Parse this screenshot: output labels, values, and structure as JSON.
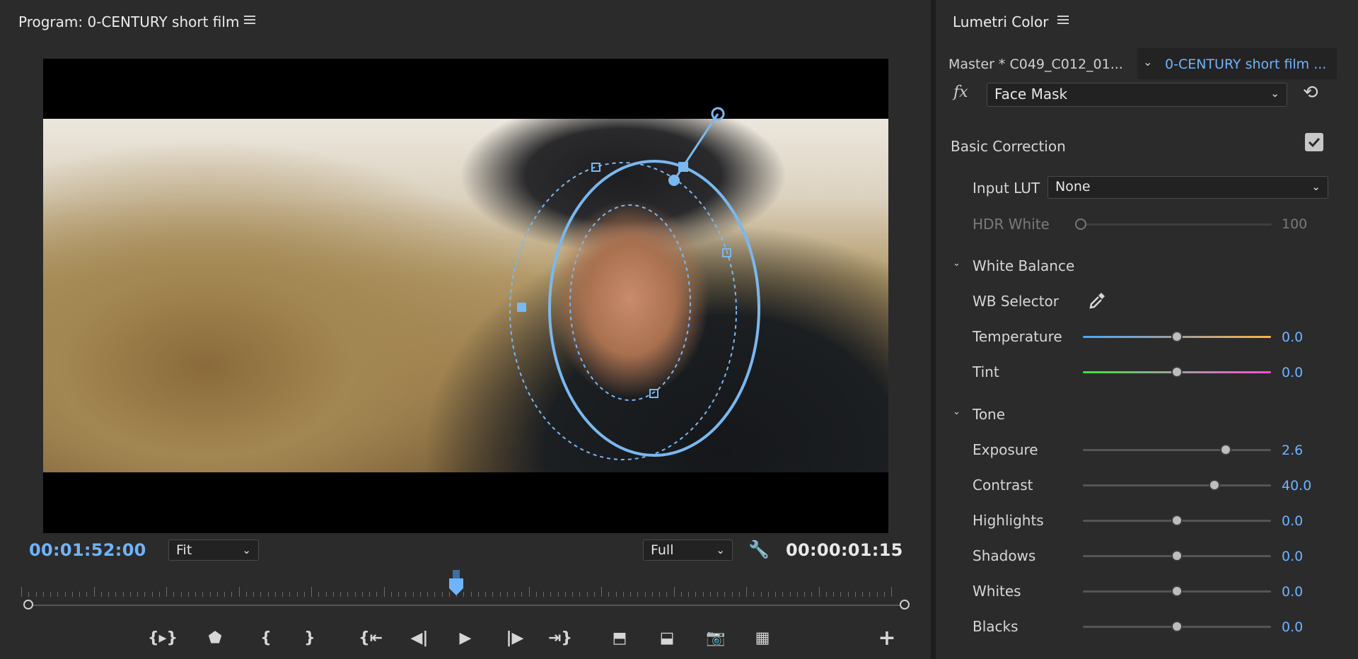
{
  "program": {
    "title": "Program: 0-CENTURY short film",
    "timecode_current": "00:01:52:00",
    "timecode_duration": "00:00:01:15",
    "zoom_select": "Fit",
    "resolution_select": "Full",
    "transport_buttons": [
      {
        "name": "mark-in-out-icon",
        "glyph": "{▸}"
      },
      {
        "name": "add-marker-icon",
        "glyph": "⬟"
      },
      {
        "name": "mark-in-icon",
        "glyph": "{"
      },
      {
        "name": "mark-out-icon",
        "glyph": "}"
      },
      {
        "name": "go-to-in-icon",
        "glyph": "{⇤"
      },
      {
        "name": "step-back-icon",
        "glyph": "◀|"
      },
      {
        "name": "play-icon",
        "glyph": "▶"
      },
      {
        "name": "step-forward-icon",
        "glyph": "|▶"
      },
      {
        "name": "go-to-out-icon",
        "glyph": "⇥}"
      },
      {
        "name": "lift-icon",
        "glyph": "⬒"
      },
      {
        "name": "extract-icon",
        "glyph": "⬓"
      },
      {
        "name": "export-frame-icon",
        "glyph": "📷"
      },
      {
        "name": "comparison-view-icon",
        "glyph": "▦"
      },
      {
        "name": "add-button-icon",
        "glyph": "+"
      }
    ],
    "playhead_position": 0.49
  },
  "lumetri": {
    "title": "Lumetri Color",
    "master_clip": "Master * C049_C012_01...",
    "sequence_clip": "0-CENTURY short film ...",
    "fx_label": "fx",
    "effect_select": "Face Mask",
    "basic_correction": {
      "heading": "Basic Correction",
      "enabled": true,
      "input_lut_label": "Input LUT",
      "input_lut_value": "None",
      "hdr_white_label": "HDR White",
      "hdr_white_value": "100",
      "hdr_white_level": 0.0
    },
    "white_balance": {
      "heading": "White Balance",
      "wb_selector_label": "WB Selector",
      "temperature": {
        "label": "Temperature",
        "value": "0.0",
        "level": 0.5
      },
      "tint": {
        "label": "Tint",
        "value": "0.0",
        "level": 0.5
      }
    },
    "tone": {
      "heading": "Tone",
      "controls": [
        {
          "label": "Exposure",
          "value": "2.6",
          "level": 0.76
        },
        {
          "label": "Contrast",
          "value": "40.0",
          "level": 0.7
        },
        {
          "label": "Highlights",
          "value": "0.0",
          "level": 0.5
        },
        {
          "label": "Shadows",
          "value": "0.0",
          "level": 0.5
        },
        {
          "label": "Whites",
          "value": "0.0",
          "level": 0.5
        },
        {
          "label": "Blacks",
          "value": "0.0",
          "level": 0.5
        }
      ]
    }
  },
  "colors": {
    "accent": "#6fb3ff",
    "mask": "#7ab8f0",
    "panel_bg": "#2b2b2b"
  }
}
